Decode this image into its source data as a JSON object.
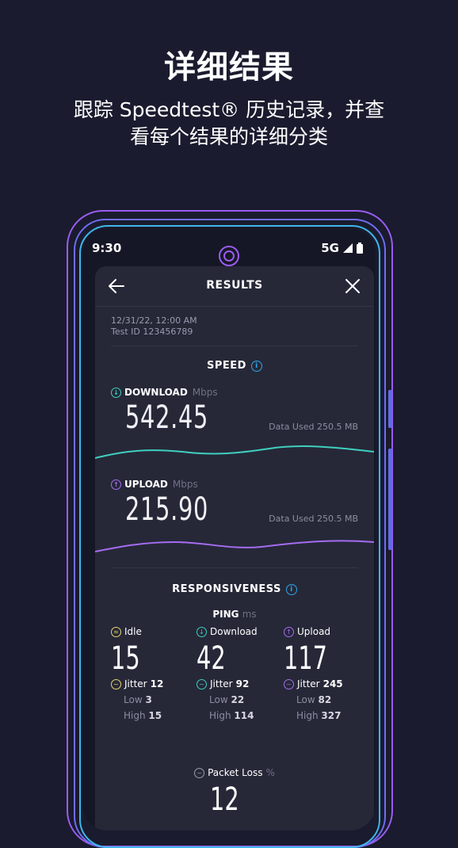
{
  "promo": {
    "title": "详细结果",
    "subtitle_line1": "跟踪 Speedtest® 历史记录，并查",
    "subtitle_line2": "看每个结果的详细分类"
  },
  "status_bar": {
    "time": "9:30",
    "network": "5G"
  },
  "results": {
    "header_title": "RESULTS",
    "date": "12/31/22, 12:00 AM",
    "test_id": "Test ID 123456789"
  },
  "speed": {
    "section_title": "SPEED",
    "download": {
      "label": "DOWNLOAD",
      "unit": "Mbps",
      "value": "542.45",
      "data_used": "Data Used 250.5 MB",
      "color": "#3fd0c0"
    },
    "upload": {
      "label": "UPLOAD",
      "unit": "Mbps",
      "value": "215.90",
      "data_used": "Data Used 250.5 MB",
      "color": "#a56cf0"
    }
  },
  "responsiveness": {
    "section_title": "RESPONSIVENESS",
    "ping_label": "PING",
    "ping_unit": "ms",
    "idle": {
      "label": "Idle",
      "value": "15",
      "jitter_label": "Jitter",
      "jitter": "12",
      "low_label": "Low",
      "low": "3",
      "high_label": "High",
      "high": "15",
      "color": "#e8d56a"
    },
    "download": {
      "label": "Download",
      "value": "42",
      "jitter_label": "Jitter",
      "jitter": "92",
      "low_label": "Low",
      "low": "22",
      "high_label": "High",
      "high": "114",
      "color": "#3fd0c0"
    },
    "upload": {
      "label": "Upload",
      "value": "117",
      "jitter_label": "Jitter",
      "jitter": "245",
      "low_label": "Low",
      "low": "82",
      "high_label": "High",
      "high": "327",
      "color": "#a56cf0"
    },
    "packet_loss_label": "Packet Loss",
    "packet_loss_unit": "%",
    "packet_loss_value": "12"
  }
}
